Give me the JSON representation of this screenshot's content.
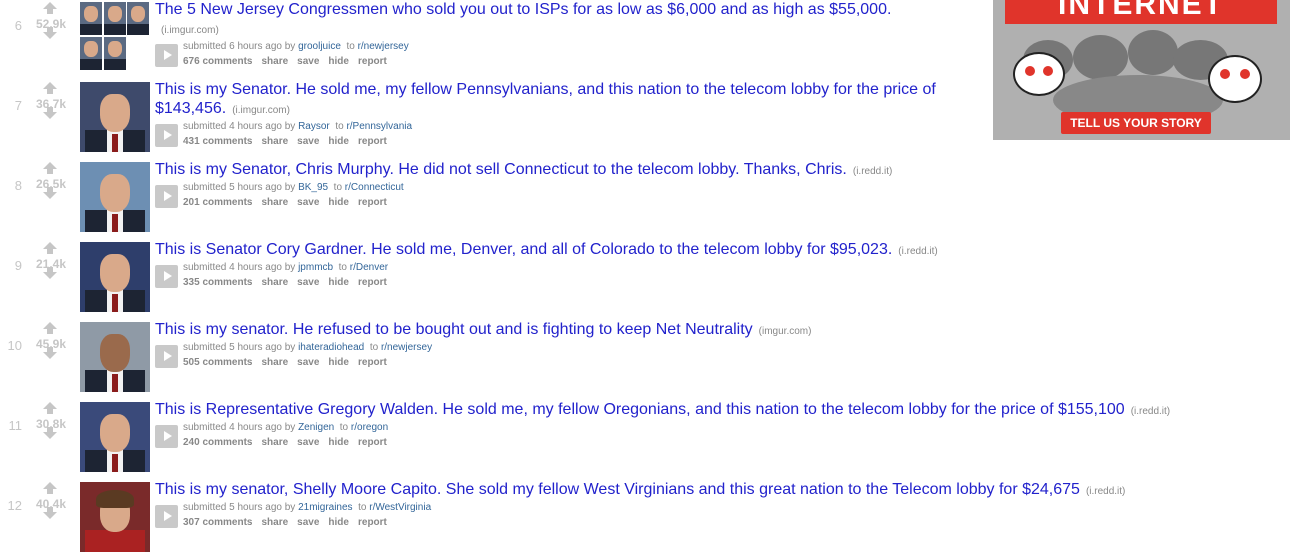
{
  "posts": [
    {
      "rank": "6",
      "score": "52.9k",
      "title": "The 5 New Jersey Congressmen who sold you out to ISPs for as low as $6,000 and as high as $55,000.",
      "domain": "(i.imgur.com)",
      "submitted": "submitted 6 hours ago by",
      "author": "grooljuice",
      "to": "to",
      "subreddit": "r/newjersey",
      "comments": "676 comments",
      "share": "share",
      "save": "save",
      "hide": "hide",
      "report": "report"
    },
    {
      "rank": "7",
      "score": "36.7k",
      "title": "This is my Senator. He sold me, my fellow Pennsylvanians, and this nation to the telecom lobby for the price of $143,456.",
      "domain": "(i.imgur.com)",
      "submitted": "submitted 4 hours ago by",
      "author": "Raysor",
      "to": "to",
      "subreddit": "r/Pennsylvania",
      "comments": "431 comments",
      "share": "share",
      "save": "save",
      "hide": "hide",
      "report": "report"
    },
    {
      "rank": "8",
      "score": "26.5k",
      "title": "This is my Senator, Chris Murphy. He did not sell Connecticut to the telecom lobby. Thanks, Chris.",
      "domain": "(i.redd.it)",
      "submitted": "submitted 5 hours ago by",
      "author": "BK_95",
      "to": "to",
      "subreddit": "r/Connecticut",
      "comments": "201 comments",
      "share": "share",
      "save": "save",
      "hide": "hide",
      "report": "report"
    },
    {
      "rank": "9",
      "score": "21.4k",
      "title": "This is Senator Cory Gardner. He sold me, Denver, and all of Colorado to the telecom lobby for $95,023.",
      "domain": "(i.redd.it)",
      "submitted": "submitted 4 hours ago by",
      "author": "jpmmcb",
      "to": "to",
      "subreddit": "r/Denver",
      "comments": "335 comments",
      "share": "share",
      "save": "save",
      "hide": "hide",
      "report": "report"
    },
    {
      "rank": "10",
      "score": "45.9k",
      "title": "This is my senator. He refused to be bought out and is fighting to keep Net Neutrality",
      "domain": "(imgur.com)",
      "submitted": "submitted 5 hours ago by",
      "author": "ihateradiohead",
      "to": "to",
      "subreddit": "r/newjersey",
      "comments": "505 comments",
      "share": "share",
      "save": "save",
      "hide": "hide",
      "report": "report"
    },
    {
      "rank": "11",
      "score": "30.8k",
      "title": "This is Representative Gregory Walden. He sold me, my fellow Oregonians, and this nation to the telecom lobby for the price of $155,100",
      "domain": "(i.redd.it)",
      "submitted": "submitted 4 hours ago by",
      "author": "Zenigen",
      "to": "to",
      "subreddit": "r/oregon",
      "comments": "240 comments",
      "share": "share",
      "save": "save",
      "hide": "hide",
      "report": "report"
    },
    {
      "rank": "12",
      "score": "40.4k",
      "title": "This is my senator, Shelly Moore Capito. She sold my fellow West Virginians and this great nation to the Telecom lobby for $24,675",
      "domain": "(i.redd.it)",
      "submitted": "submitted 5 hours ago by",
      "author": "21migraines",
      "to": "to",
      "subreddit": "r/WestVirginia",
      "comments": "307 comments",
      "share": "share",
      "save": "save",
      "hide": "hide",
      "report": "report"
    }
  ],
  "ad": {
    "banner": "INTERNET",
    "button": "TELL US YOUR STORY"
  },
  "colors": {
    "title_link": "#2222cc",
    "meta_link": "#336699",
    "muted": "#888888",
    "vote_arrow": "#c6c6c6",
    "ad_red": "#e0342b"
  }
}
